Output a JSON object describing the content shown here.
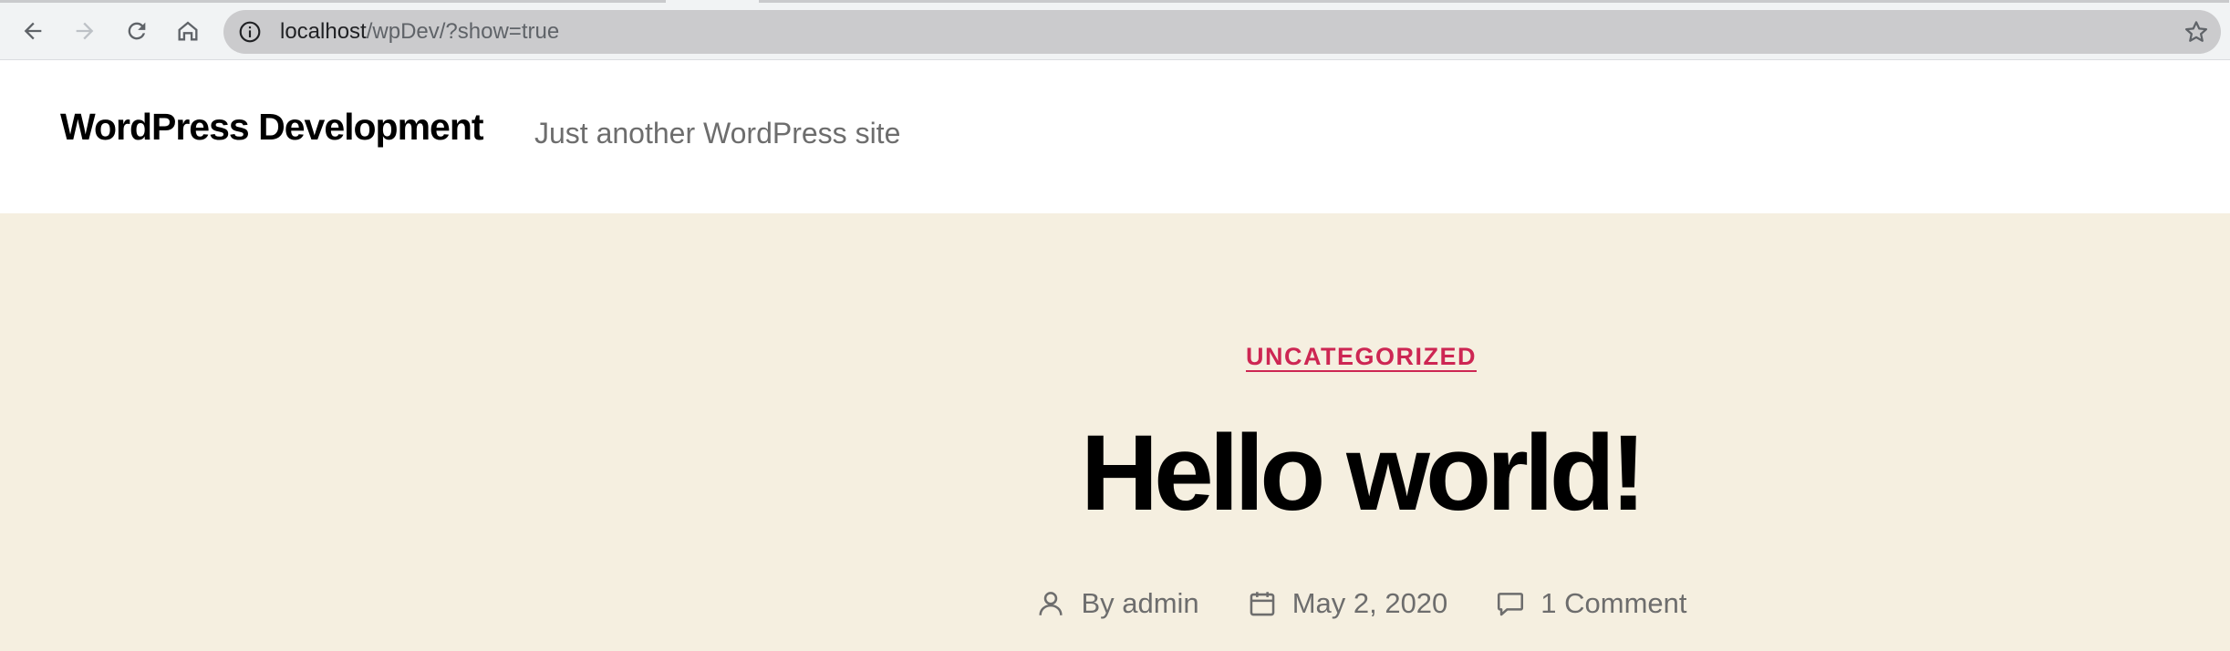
{
  "browser": {
    "url_host": "localhost",
    "url_path": "/wpDev/?show=true",
    "icons": {
      "back": "arrow-left-icon",
      "forward": "arrow-right-icon",
      "reload": "reload-icon",
      "home": "home-icon",
      "info": "info-icon",
      "bookmark": "star-icon"
    }
  },
  "site": {
    "title": "WordPress Development",
    "description": "Just another WordPress site"
  },
  "post": {
    "category": "UNCATEGORIZED",
    "title": "Hello world!",
    "author": "By admin",
    "date": "May 2, 2020",
    "comments": "1 Comment"
  },
  "colors": {
    "accent": "#cd2653",
    "header_bg": "#f5efe0",
    "meta_text": "#6d6d6d"
  }
}
